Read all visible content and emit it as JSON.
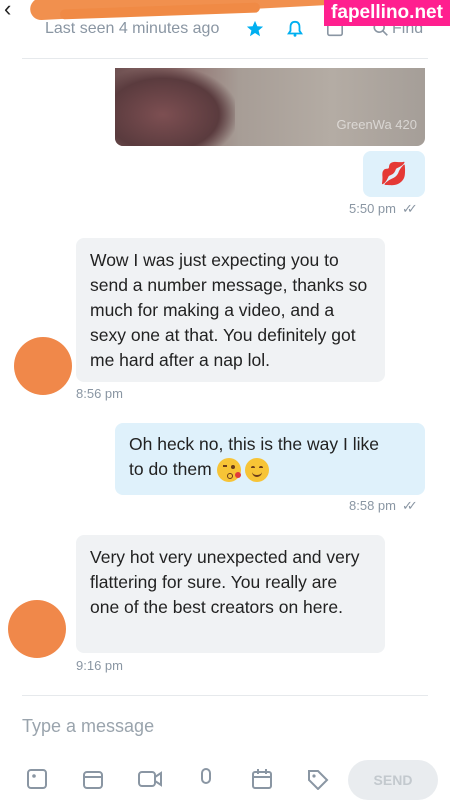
{
  "watermark": "fapellino.net",
  "header": {
    "last_seen": "Last seen 4 minutes ago",
    "find_label": "Find",
    "icons": [
      "back-icon",
      "star-icon",
      "bell-icon",
      "image-icon",
      "search-icon"
    ]
  },
  "messages": [
    {
      "type": "photo",
      "direction": "out",
      "overlay_text": "GreenWa 420"
    },
    {
      "type": "emoji",
      "direction": "out",
      "content": "💋",
      "time": "5:50 pm",
      "read": true
    },
    {
      "type": "text",
      "direction": "in",
      "text": "Wow I was just expecting you to send a number message, thanks so much for making a video, and a sexy one at that. You definitely got me hard after a nap lol.",
      "time": "8:56 pm"
    },
    {
      "type": "text",
      "direction": "out",
      "text_line1": "Oh heck no, this is the way I like",
      "text_line2": "to do them",
      "emojis": [
        "😘",
        "😊"
      ],
      "time": "8:58 pm",
      "read": true
    },
    {
      "type": "text",
      "direction": "in",
      "text": "Very hot very unexpected and very flattering for sure. You really are one of the best creators on here.",
      "time": "9:16 pm"
    }
  ],
  "composer": {
    "placeholder": "Type a message",
    "send_label": "SEND",
    "icons": [
      "image-icon",
      "vault-icon",
      "video-icon",
      "microphone-icon",
      "calendar-icon",
      "price-tag-icon"
    ]
  },
  "colors": {
    "outgoing_bubble": "#dff1fb",
    "incoming_bubble": "#f0f2f4",
    "accent": "#00aff0",
    "watermark": "#ff1f8f"
  }
}
